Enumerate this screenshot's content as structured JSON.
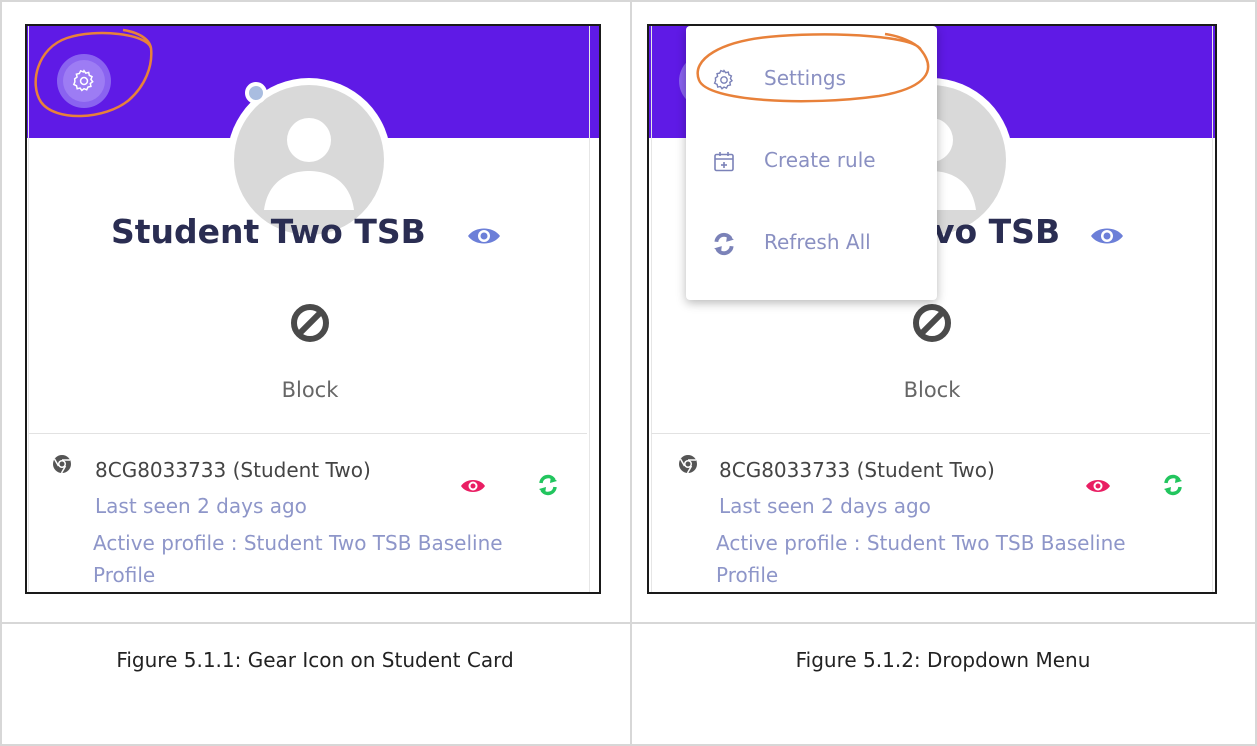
{
  "panels": [
    {
      "student_name": "Student Two TSB",
      "block_label": "Block",
      "device_name": "8CG8033733 (Student Two)",
      "last_seen": "Last seen 2 days ago",
      "active_profile_line1": "Active profile : Student Two TSB Baseline",
      "active_profile_line2": "Profile",
      "caption": "Figure 5.1.1: Gear Icon on Student Card"
    },
    {
      "student_name_visible": "vo TSB",
      "block_label": "Block",
      "device_name": "8CG8033733 (Student Two)",
      "last_seen": "Last seen 2 days ago",
      "active_profile_line1": "Active profile : Student Two TSB Baseline",
      "active_profile_line2": "Profile",
      "caption": "Figure 5.1.2: Dropdown Menu",
      "menu": {
        "items": [
          {
            "label": "Settings",
            "icon": "gear-icon"
          },
          {
            "label": "Create rule",
            "icon": "calendar-plus-icon"
          },
          {
            "label": "Refresh All",
            "icon": "refresh-icon"
          }
        ]
      }
    }
  ],
  "colors": {
    "banner": "#5f1ae6",
    "annotation": "#e8813a",
    "eye_view": "#6c7fd8",
    "eye_device": "#e91e63",
    "refresh": "#22c55e",
    "muted_text": "#8e96c9",
    "name_text": "#2a2d52"
  }
}
